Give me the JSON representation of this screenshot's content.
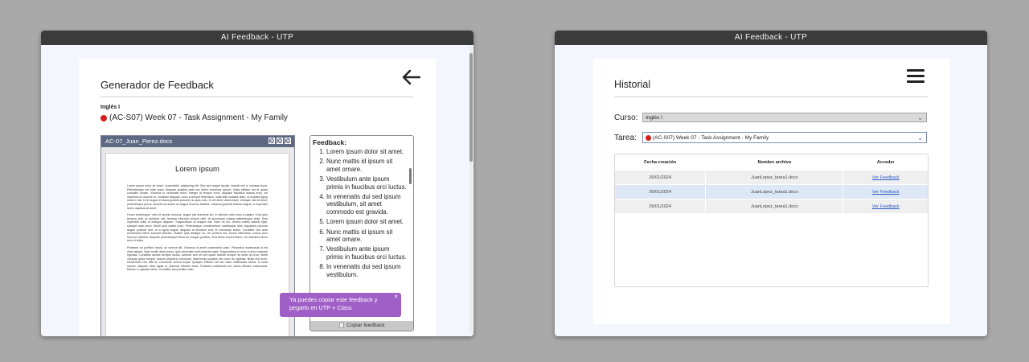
{
  "left_window": {
    "title": "AI Feedback - UTP",
    "heading": "Generador de Feedback",
    "course": "Inglés I",
    "task": "(AC-S07) Week 07 - Task Assignment - My Family",
    "doc": {
      "filename": "AC-07_Juan_Perez.docx",
      "title": "Lorem ipsum",
      "paragraphs": [
        "Lorem ipsum dolor sit amet, consectetur adipiscing elit. Sed sed augue iaculis, blandit nisl a, volutpat dolor. Pellentesque vel enim justo. Aliquam sodales ante nec libero maximus rutrum. Nulla efficitur est et quam convallis ornare. Vivamus in venenatis enim. Integer id tempor nunc. Aliquam faucibus massa eros, vel maximus mi ultrices id. Curabitur aliquam, nunc a tempor bibendum, nulla felis sodales diam, id sodales ligula nulla in nisl. Ut in augue et lacus gravida posuere ac quis odio. In vel dolor ullamcorper, tristique nisl sit amet, pellentesque purus. Aenean eu lectus ut magna rhoncus facilisis. Vivamus gravida finibus magna, in imperdiet lorem dapibus sit amet.",
        "Fusce scelerisque, odio et lacinia rhoncus, augue nisi maximus leo, in ultricies odio nunc a sapien. Cras quis tempus velit, at faucibus nisl. Aenean interdum dictum nibh, at accumsan massa pellentesque vitae. Duis imperdiet nulla in tristique aliquam. Suspendisse at magna nisl. Nam mi leo, viverra mattis blandit eget, suscipit vitae tortor. Morbi quis mattis nunc. Pellentesque condimentum malesuada nibh, dignissim pulvinar augue pulvinar sed. Ut a ligula augue. Aliquam at tincidunt erat, et commodo lectus. Curabitur non ante elementum libero suscipit ultricies. Nullam quis tristique mi, vel pretium est. Donec bibendum cursus arcu rhoncus ultricies. Aliquam pellentesque libero ac congue porttitor, eros tellus viverra libero, vel interdum libero sem et tellus.",
        "Praesent eu porttitor turpis, ac viverra elit. Vivamus ut amet consectetur justo. Phasellus malesuada id est vitae aliquet. Nam mollis diam purus, quis venenatis velit pharetra eget. Suspendisse et nunc in arcu molestie egestas. Curabitur lacinia semper luctus. Aenean sed mi sed quam blandit semper sit amet at urna. Morbi volutpat quam tempor mauris pharetra commodo. Maecenas sodales nec nunc at egestas. Nulla nisl enim, elementum nec felis id, commodo viverra turpis. Quisque efficitur est nec risus malesuada varius. In nulla mauris, aliquam vitae ligula in, placerat ultricies risus. Praesent sollicitudin leo varius efficitur malesuada. Mauris in egestas libero. Curabitur sed porttitor odio."
      ]
    },
    "feedback": {
      "title": "Feedback:",
      "items": [
        "Lorem ipsum dolor sit amet.",
        "Nunc mattis id ipsum sit amet ornare.",
        "Vestibulum ante ipsum primis in faucibus orci luctus.",
        "In venenatis dui sed ipsum vestibulum, sit amet commodo est gravida.",
        "Lorem ipsum dolor sit amet.",
        "Nunc mattis id ipsum sit amet ornare.",
        "Vestibulum ante ipsum primis in faucibus orci luctus.",
        "In venenatis dui sed ipsum vestibulum."
      ],
      "copy_label": "Copiar feedback"
    },
    "toast": {
      "text": "Ya puedes copiar este feedback y pegarlo en UTP + Class",
      "close": "×"
    }
  },
  "right_window": {
    "title": "AI Feedback - UTP",
    "heading": "Historial",
    "course_label": "Curso:",
    "course_value": "Inglés I",
    "task_label": "Tarea:",
    "task_value": "(AC-S07) Week 07 - Task Assignment - My Family",
    "table": {
      "headers": [
        "Fecha creación",
        "Nombre archivo",
        "Acceder"
      ],
      "rows": [
        [
          "26/01/2024",
          "JuanLopez_tarea1.docx",
          "Ver Feedback"
        ],
        [
          "26/01/2024",
          "JuanLopez_tarea1.docx",
          "Ver Feedback"
        ],
        [
          "26/01/2024",
          "JuanLopez_tarea1.docx",
          "Ver Feedback"
        ]
      ]
    }
  },
  "colors": {
    "titlebar": "#3b3b3b",
    "doc_header": "#5d6883",
    "toast": "#a05ec7",
    "link": "#2d5ac8",
    "status_dot": "#d62020"
  },
  "icons": [
    "back-arrow-icon",
    "menu-icon",
    "chevron-down-icon",
    "close-icon",
    "clipboard-icon"
  ]
}
